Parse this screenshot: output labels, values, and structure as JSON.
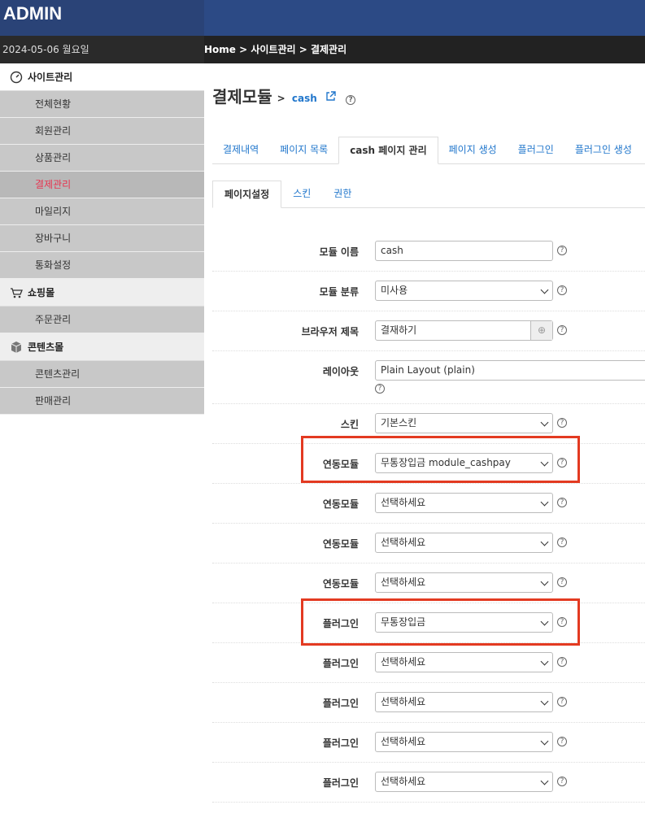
{
  "header": {
    "brand": "ADMIN",
    "date": "2024-05-06 월요일",
    "breadcrumb": "Home > 사이트관리 > 결제관리"
  },
  "sidebar": {
    "sections": [
      {
        "title": "사이트관리",
        "icon": "dashboard-icon",
        "items": [
          "전체현황",
          "회원관리",
          "상품관리",
          "결제관리",
          "마일리지",
          "장바구니",
          "통화설정"
        ]
      },
      {
        "title": "쇼핑몰",
        "icon": "cart-icon",
        "items": [
          "주문관리"
        ]
      },
      {
        "title": "콘텐츠몰",
        "icon": "box-icon",
        "items": [
          "콘텐츠관리",
          "판매관리"
        ]
      }
    ],
    "active_item": "결제관리"
  },
  "page": {
    "title": "결제모듈",
    "sub_prefix": ">",
    "sub_link": "cash"
  },
  "tabs_main": [
    "결제내역",
    "페이지 목록",
    "cash 페이지 관리",
    "페이지 생성",
    "플러그인",
    "플러그인 생성"
  ],
  "tabs_main_active": "cash 페이지 관리",
  "tabs_sub": [
    "페이지설정",
    "스킨",
    "권한"
  ],
  "tabs_sub_active": "페이지설정",
  "form": {
    "module_name": {
      "label": "모듈 이름",
      "value": "cash"
    },
    "module_category": {
      "label": "모듈 분류",
      "value": "미사용"
    },
    "browser_title": {
      "label": "브라우저 제목",
      "value": "결재하기"
    },
    "layout": {
      "label": "레이아웃",
      "value": "Plain Layout (plain)"
    },
    "skin": {
      "label": "스킨",
      "value": "기본스킨"
    },
    "linked_modules": [
      {
        "label": "연동모듈",
        "value": "무통장입금 module_cashpay"
      },
      {
        "label": "연동모듈",
        "value": "선택하세요"
      },
      {
        "label": "연동모듈",
        "value": "선택하세요"
      },
      {
        "label": "연동모듈",
        "value": "선택하세요"
      }
    ],
    "plugins": [
      {
        "label": "플러그인",
        "value": "무통장입금"
      },
      {
        "label": "플러그인",
        "value": "선택하세요"
      },
      {
        "label": "플러그인",
        "value": "선택하세요"
      },
      {
        "label": "플러그인",
        "value": "선택하세요"
      },
      {
        "label": "플러그인",
        "value": "선택하세요"
      }
    ]
  },
  "colors": {
    "header": "#2c4a85",
    "active_item": "#e8324e",
    "link": "#2277cc",
    "highlight": "#e33a21"
  }
}
